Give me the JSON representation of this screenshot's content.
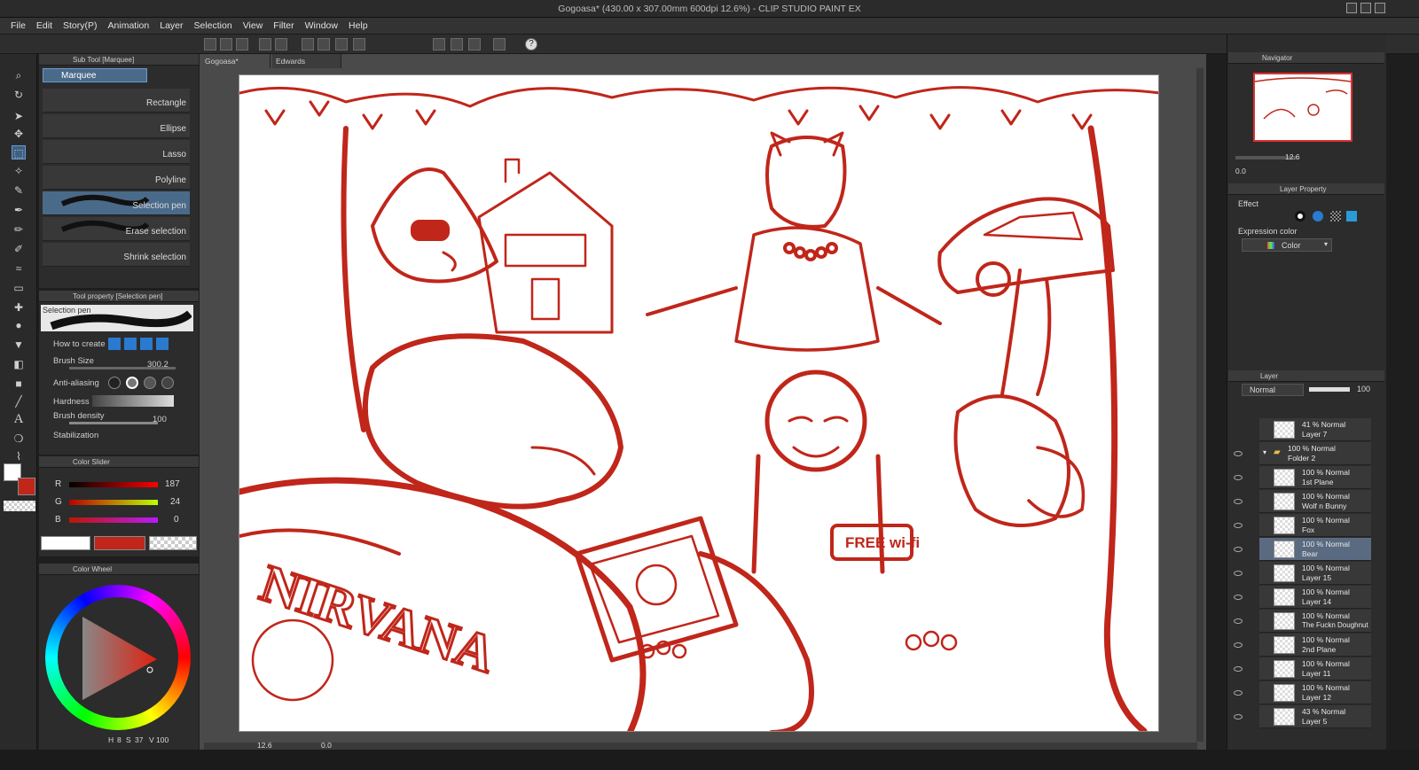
{
  "window": {
    "title": "Gogoasa* (430.00 x 307.00mm 600dpi 12.6%) - CLIP STUDIO PAINT EX"
  },
  "menu": [
    "File",
    "Edit",
    "Story(P)",
    "Animation",
    "Layer",
    "Selection",
    "View",
    "Filter",
    "Window",
    "Help"
  ],
  "subtool": {
    "header": "Sub Tool [Marquee]",
    "group_label": "Marquee",
    "items": [
      "Rectangle",
      "Ellipse",
      "Lasso",
      "Polyline",
      "Selection pen",
      "Erase selection",
      "Shrink selection"
    ]
  },
  "tool_property": {
    "header": "Tool property [Selection pen]",
    "brush_name": "Selection pen",
    "how_to_create": "How to create",
    "brush_size_label": "Brush Size",
    "brush_size_value": "300.2",
    "antialiasing_label": "Anti-aliasing",
    "hardness_label": "Hardness",
    "brush_density_label": "Brush density",
    "brush_density_value": "100",
    "stabilization_label": "Stabilization"
  },
  "color_slider": {
    "header": "Color Slider",
    "r_label": "R",
    "r_value": "187",
    "g_label": "G",
    "g_value": "24",
    "b_label": "B",
    "b_value": "0"
  },
  "color_wheel": {
    "header": "Color Wheel",
    "h_label": "H",
    "h_value": "8",
    "s_label": "S",
    "s_value": "37",
    "v_label": "V",
    "v_value": "100"
  },
  "doc_tabs": [
    "Gogoasa*",
    "Edwards"
  ],
  "canvas": {
    "sign_text": "FREE wi-fi",
    "shirt_text": "NIRVANA"
  },
  "zoom_value": "12.6",
  "rotate_value": "0.0",
  "navigator": {
    "header": "Navigator",
    "zoom": "12.6",
    "rotate": "0.0"
  },
  "layer_property": {
    "header": "Layer Property",
    "effect_label": "Effect",
    "expression_label": "Expression color",
    "expression_value": "Color"
  },
  "layer_panel": {
    "header": "Layer",
    "blend_mode": "Normal",
    "opacity": "100",
    "layers": [
      {
        "pct": "41 %  Normal",
        "name": "Layer 7"
      },
      {
        "pct": "100 %  Normal",
        "name": "Folder 2"
      },
      {
        "pct": "100 %  Normal",
        "name": "1st Plane"
      },
      {
        "pct": "100 %  Normal",
        "name": "Wolf n Bunny"
      },
      {
        "pct": "100 %  Normal",
        "name": "Fox"
      },
      {
        "pct": "100 %  Normal",
        "name": "Bear"
      },
      {
        "pct": "100 %  Normal",
        "name": "Layer 15"
      },
      {
        "pct": "100 %  Normal",
        "name": "Layer 14"
      },
      {
        "pct": "100 %  Normal",
        "name": "The Fuckn Doughnut"
      },
      {
        "pct": "100 %  Normal",
        "name": "2nd Plane"
      },
      {
        "pct": "100 %  Normal",
        "name": "Layer 11"
      },
      {
        "pct": "100 %  Normal",
        "name": "Layer 12"
      },
      {
        "pct": "43 %  Normal",
        "name": "Layer 5"
      }
    ]
  },
  "colors": {
    "accent": "#c0261a",
    "canvas_bg": "#ffffff",
    "ui_bg": "#2c2c2c"
  }
}
